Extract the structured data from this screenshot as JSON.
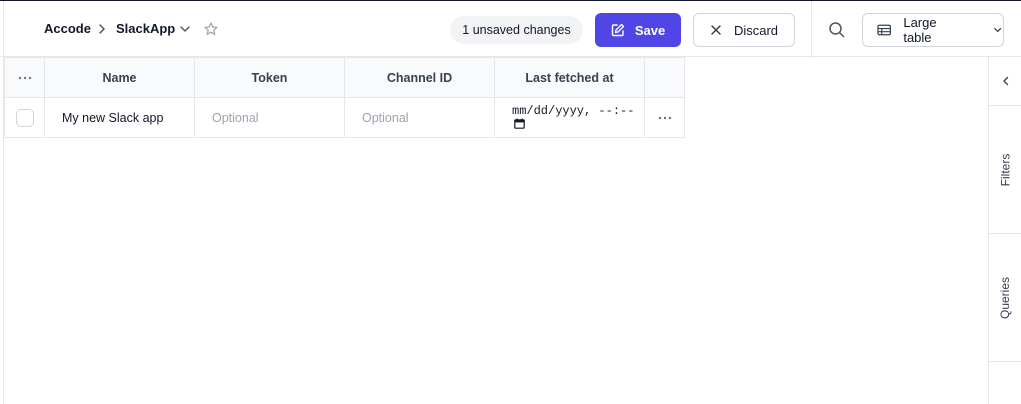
{
  "breadcrumb": {
    "workspace": "Accode",
    "table": "SlackApp"
  },
  "toolbar": {
    "unsaved_label": "1 unsaved changes",
    "save_label": "Save",
    "discard_label": "Discard",
    "size_label": "Large table"
  },
  "grid": {
    "columns": [
      "Name",
      "Token",
      "Channel ID",
      "Last fetched at"
    ],
    "rows": [
      {
        "name": "My new Slack app",
        "token_placeholder": "Optional",
        "channel_placeholder": "Optional",
        "last_fetched": "mm/dd/yyyy, --:--"
      }
    ]
  },
  "side_panel": {
    "tabs": [
      "Filters",
      "Queries"
    ]
  },
  "icons": {
    "breadcrumb_separator": "chevron-right-icon",
    "table_menu": "chevron-down-icon",
    "favorite": "star-icon",
    "save": "pencil-square-icon",
    "discard": "x-icon",
    "search": "search-icon",
    "size": "table-icon",
    "size_menu": "chevron-down-icon",
    "column_menu": "ellipsis-icon",
    "row_menu": "ellipsis-icon",
    "calendar": "calendar-icon",
    "collapse": "chevron-left-icon"
  },
  "colors": {
    "accent": "#4f46e5",
    "border": "#e5e7eb",
    "header_bg": "#f9fafb",
    "pill_bg": "#f1f3f5",
    "placeholder": "#9ca3af"
  }
}
